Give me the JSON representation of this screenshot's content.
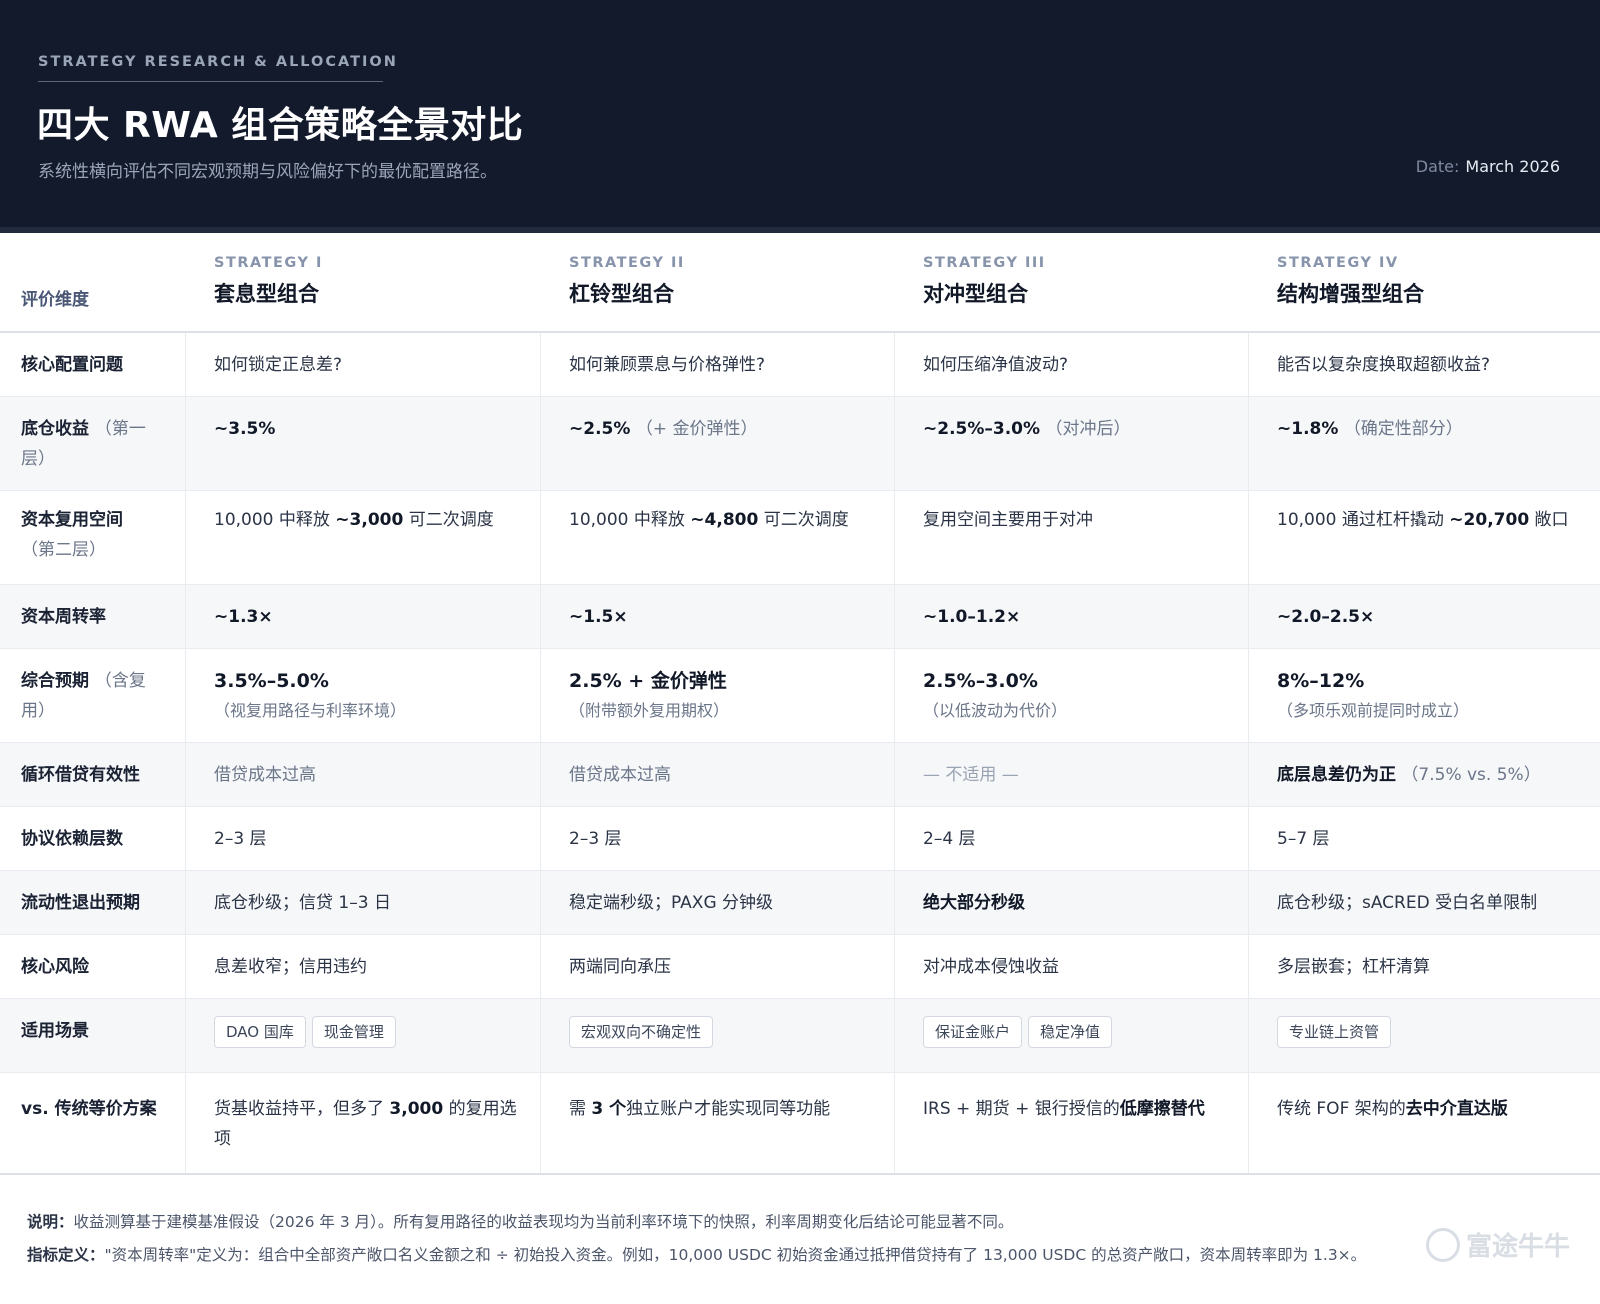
{
  "header": {
    "eyebrow": "STRATEGY RESEARCH & ALLOCATION",
    "title": "四大 RWA 组合策略全景对比",
    "subtitle": "系统性横向评估不同宏观预期与风险偏好下的最优配置路径。",
    "date_label": "Date:",
    "date_value": "March 2026"
  },
  "table": {
    "dim_header": "评价维度",
    "strategies": [
      {
        "label": "STRATEGY I",
        "name": "套息型组合"
      },
      {
        "label": "STRATEGY II",
        "name": "杠铃型组合"
      },
      {
        "label": "STRATEGY III",
        "name": "对冲型组合"
      },
      {
        "label": "STRATEGY IV",
        "name": "结构增强型组合"
      }
    ],
    "rows": {
      "core_question": {
        "dim": "核心配置问题",
        "cells": [
          "如何锁定正息差?",
          "如何兼顾票息与价格弹性?",
          "如何压缩净值波动?",
          "能否以复杂度换取超额收益?"
        ]
      },
      "base_yield": {
        "dim": "底仓收益",
        "dim_note": "（第一层）",
        "cells": [
          {
            "value": "~3.5%",
            "note": ""
          },
          {
            "value": "~2.5%",
            "note": "（+ 金价弹性）"
          },
          {
            "value": "~2.5%–3.0%",
            "note": "（对冲后）"
          },
          {
            "value": "~1.8%",
            "note": "（确定性部分）"
          }
        ]
      },
      "reuse_space": {
        "dim": "资本复用空间",
        "dim_note": "（第二层）",
        "cells": [
          {
            "pre": "10,000 中释放 ",
            "strong": "~3,000",
            "post": " 可二次调度"
          },
          {
            "pre": "10,000 中释放 ",
            "strong": "~4,800",
            "post": " 可二次调度"
          },
          {
            "pre": "复用空间主要用于对冲",
            "strong": "",
            "post": ""
          },
          {
            "pre": "10,000 通过杠杆撬动 ",
            "strong": "~20,700",
            "post": " 敞口"
          }
        ]
      },
      "turnover": {
        "dim": "资本周转率",
        "cells": [
          "~1.3×",
          "~1.5×",
          "~1.0–1.2×",
          "~2.0–2.5×"
        ]
      },
      "expected": {
        "dim": "综合预期",
        "dim_note": "（含复用）",
        "cells": [
          {
            "value": "3.5%–5.0%",
            "note": "（视复用路径与利率环境）"
          },
          {
            "value": "2.5% + 金价弹性",
            "note": "（附带额外复用期权）"
          },
          {
            "value": "2.5%–3.0%",
            "note": "（以低波动为代价）"
          },
          {
            "value": "8%–12%",
            "note": "（多项乐观前提同时成立）"
          }
        ]
      },
      "loop_lending": {
        "dim": "循环借贷有效性",
        "cells": [
          {
            "strong": "",
            "text": "借贷成本过高"
          },
          {
            "strong": "",
            "text": "借贷成本过高"
          },
          {
            "strong": "",
            "text": "— 不适用 —"
          },
          {
            "strong": "底层息差仍为正",
            "text": "（7.5% vs. 5%）"
          }
        ]
      },
      "protocol_layers": {
        "dim": "协议依赖层数",
        "cells": [
          "2–3 层",
          "2–3 层",
          "2–4 层",
          "5–7 层"
        ]
      },
      "liquidity": {
        "dim": "流动性退出预期",
        "cells": [
          "底仓秒级；信贷 1–3 日",
          "稳定端秒级；PAXG 分钟级",
          "绝大部分秒级",
          "底仓秒级；sACRED 受白名单限制"
        ]
      },
      "risk": {
        "dim": "核心风险",
        "cells": [
          "息差收窄；信用违约",
          "两端同向承压",
          "对冲成本侵蚀收益",
          "多层嵌套；杠杆清算"
        ]
      },
      "scenarios": {
        "dim": "适用场景",
        "cells": [
          [
            "DAO 国库",
            "现金管理"
          ],
          [
            "宏观双向不确定性"
          ],
          [
            "保证金账户",
            "稳定净值"
          ],
          [
            "专业链上资管"
          ]
        ]
      },
      "vs_traditional": {
        "dim": "vs. 传统等价方案",
        "cells": [
          {
            "pre": "货基收益持平，但多了 ",
            "strong": "3,000",
            "post": " 的复用选项"
          },
          {
            "pre": "需 ",
            "strong": "3 个",
            "post": "独立账户才能实现同等功能"
          },
          {
            "pre": "IRS + 期货 + 银行授信的",
            "strong": "低摩擦替代",
            "post": ""
          },
          {
            "pre": "传统 FOF 架构的",
            "strong": "去中介直达版",
            "post": ""
          }
        ]
      }
    }
  },
  "footer": {
    "note_label": "说明：",
    "note_text": "收益测算基于建模基准假设（2026 年 3 月）。所有复用路径的收益表现均为当前利率环境下的快照，利率周期变化后结论可能显著不同。",
    "def_label": "指标定义：",
    "def_text": "\"资本周转率\"定义为：组合中全部资产敞口名义金额之和 ÷ 初始投入资金。例如，10,000 USDC 初始资金通过抵押借贷持有了 13,000 USDC 的总资产敞口，资本周转率即为 1.3×。"
  },
  "watermark": {
    "text": "富途牛牛",
    "icon": "futu-logo-icon"
  }
}
